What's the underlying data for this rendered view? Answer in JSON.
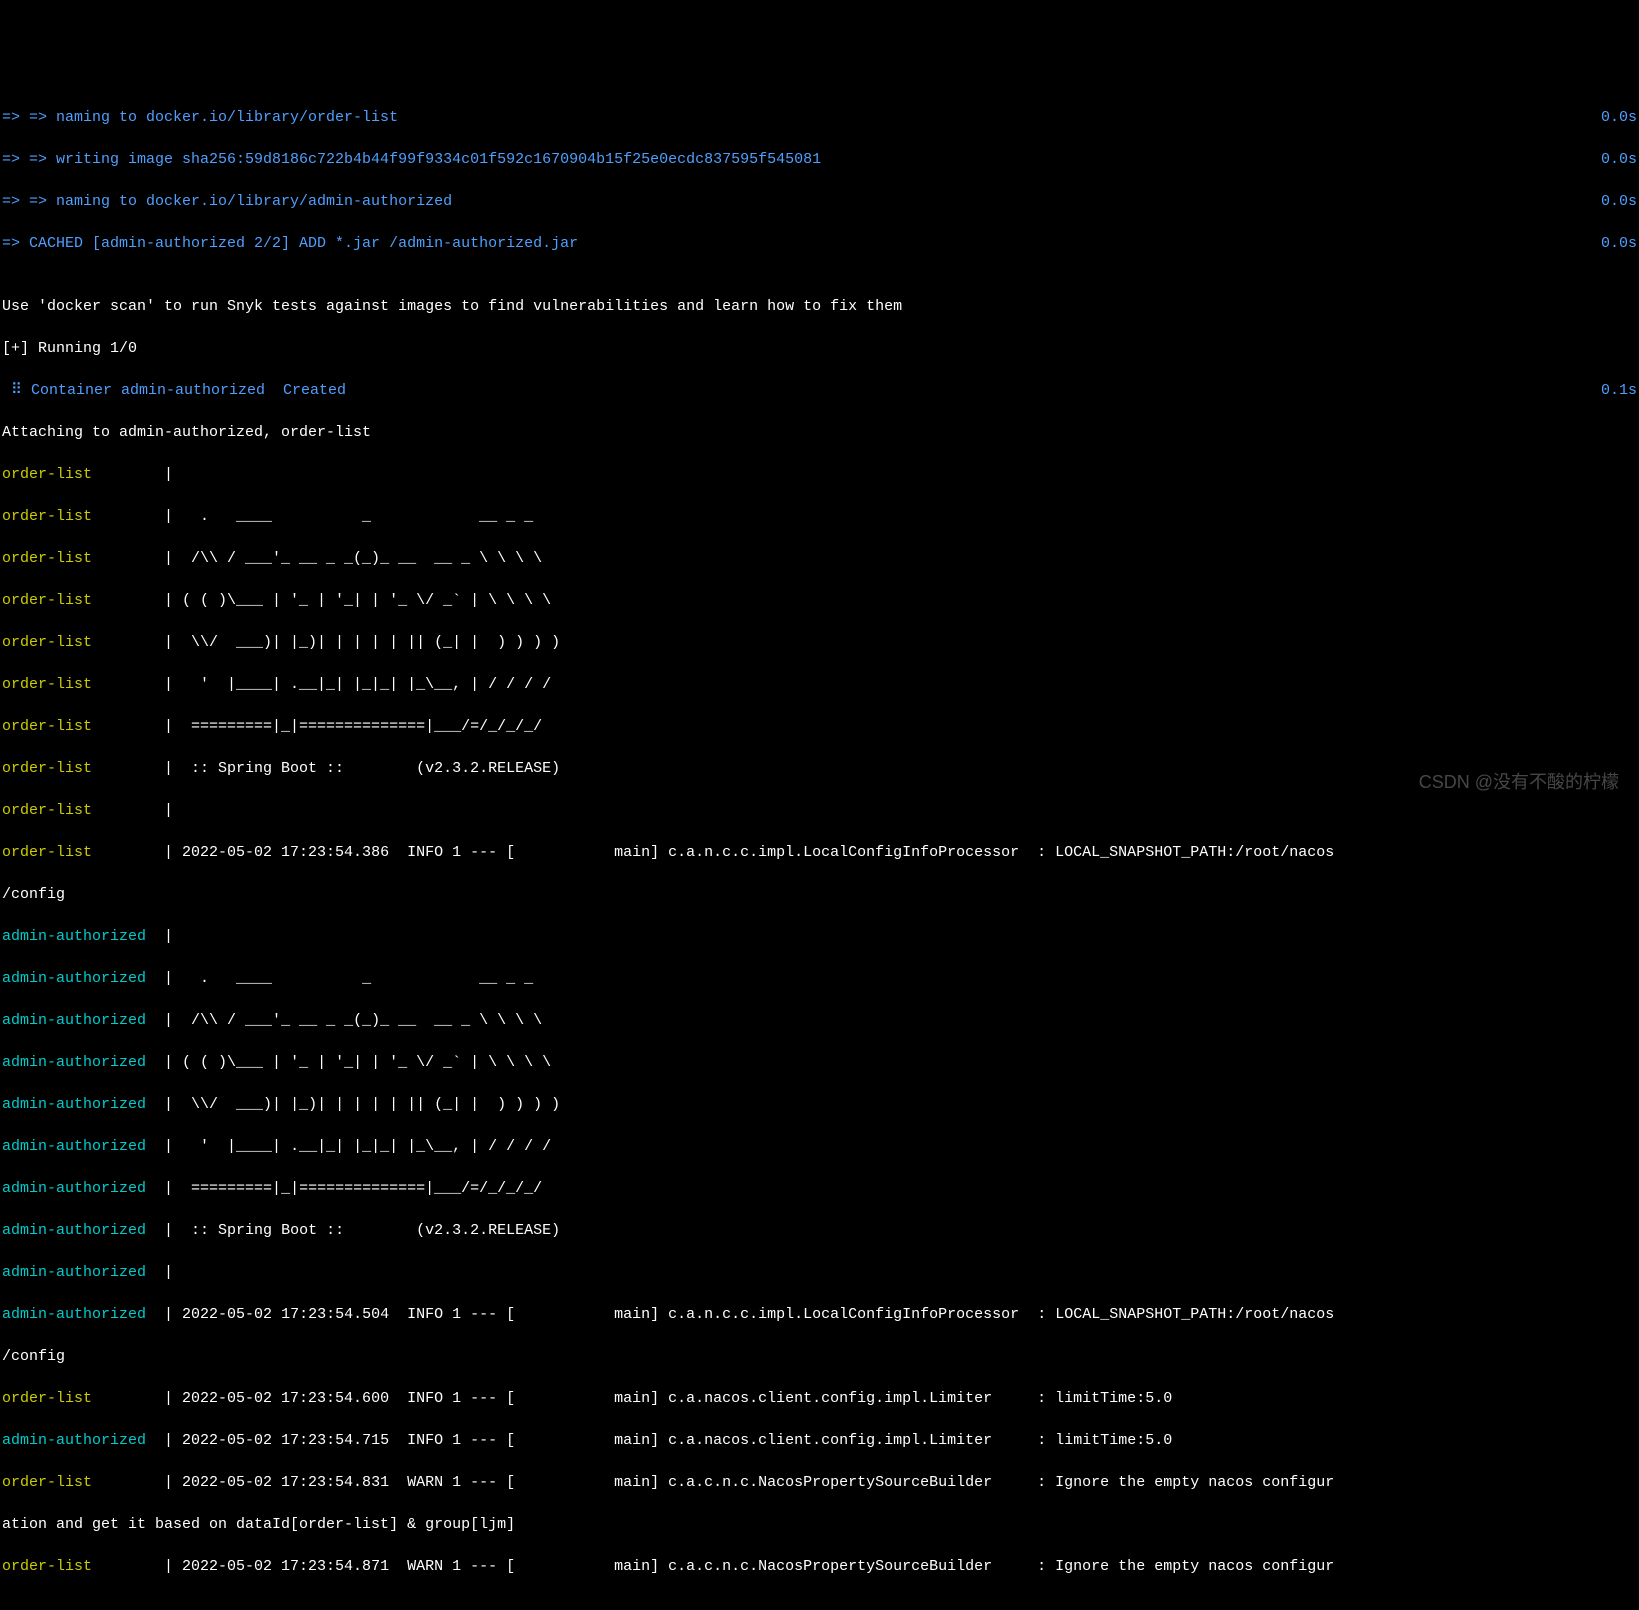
{
  "build": {
    "line1_left": "=> => naming to docker.io/library/order-list",
    "line1_right": "0.0s",
    "line2_left": "=> => writing image sha256:59d8186c722b4b44f99f9334c01f592c1670904b15f25e0ecdc837595f545081",
    "line2_right": "0.0s",
    "line3_left": "=> => naming to docker.io/library/admin-authorized",
    "line3_right": "0.0s",
    "line4_left": "=> CACHED [admin-authorized 2/2] ADD *.jar /admin-authorized.jar",
    "line4_right": "0.0s"
  },
  "blank": "",
  "scan_hint": "Use 'docker scan' to run Snyk tests against images to find vulnerabilities and learn how to fix them",
  "running": "[+] Running 1/0",
  "container_line_left": " ⠿ Container admin-authorized  Created",
  "container_line_right": "0.1s",
  "attaching": "Attaching to admin-authorized, order-list",
  "svc": {
    "order": "order-list",
    "admin": "admin-authorized"
  },
  "sep": "  | ",
  "spring": {
    "l1": "  .   ____          _            __ _ _",
    "l2": " /\\\\ / ___'_ __ _ _(_)_ __  __ _ \\ \\ \\ \\",
    "l3": "( ( )\\___ | '_ | '_| | '_ \\/ _` | \\ \\ \\ \\",
    "l4": " \\\\/  ___)| |_)| | | | | || (_| |  ) ) ) )",
    "l5": "  '  |____| .__|_| |_|_| |_\\__, | / / / /",
    "l6": " =========|_|==============|___/=/_/_/_/",
    "l7": " :: Spring Boot ::        (v2.3.2.RELEASE)"
  },
  "logs": {
    "order_info1": " 2022-05-02 17:23:54.386  INFO 1 --- [           main] c.a.n.c.c.impl.LocalConfigInfoProcessor  : LOCAL_SNAPSHOT_PATH:/root/nacos",
    "config_path": "/config",
    "admin_info1": " 2022-05-02 17:23:54.504  INFO 1 --- [           main] c.a.n.c.c.impl.LocalConfigInfoProcessor  : LOCAL_SNAPSHOT_PATH:/root/nacos",
    "order_info2": " 2022-05-02 17:23:54.600  INFO 1 --- [           main] c.a.nacos.client.config.impl.Limiter     : limitTime:5.0",
    "admin_info2": " 2022-05-02 17:23:54.715  INFO 1 --- [           main] c.a.nacos.client.config.impl.Limiter     : limitTime:5.0",
    "order_warn1": " 2022-05-02 17:23:54.831  WARN 1 --- [           main] c.a.c.n.c.NacosPropertySourceBuilder     : Ignore the empty nacos configur",
    "warn_wrap": "ation and get it based on dataId[order-list] & group[ljm]",
    "order_warn2": " 2022-05-02 17:23:54.871  WARN 1 --- [           main] c.a.c.n.c.NacosPropertySourceBuilder     : Ignore the empty nacos configur"
  },
  "watermark": "CSDN @没有不酸的柠檬"
}
